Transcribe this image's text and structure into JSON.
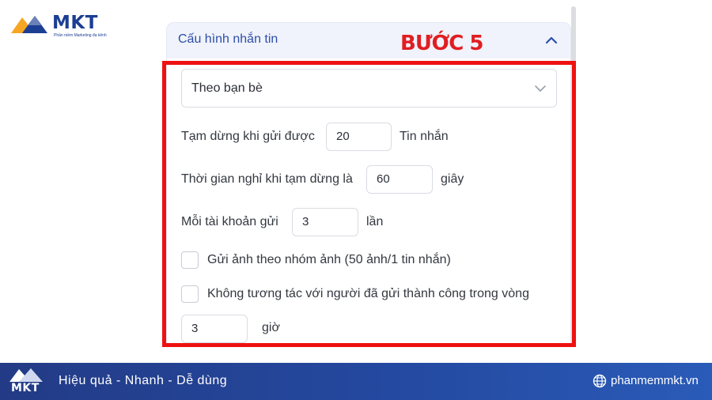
{
  "brand": {
    "logo_text": "MKT",
    "logo_tagline": "Phần mềm Marketing đa kênh"
  },
  "step_label": "BƯỚC 5",
  "panel": {
    "title": "Cấu hình nhắn tin",
    "select_value": "Theo bạn bè",
    "pause_row": {
      "label": "Tạm dừng khi gửi được",
      "value": "20",
      "unit": "Tin nhắn"
    },
    "rest_row": {
      "label": "Thời gian nghỉ khi tạm dừng là",
      "value": "60",
      "unit": "giây"
    },
    "per_account_row": {
      "label": "Mỗi tài khoản gửi",
      "value": "3",
      "unit": "lần"
    },
    "checkbox_group_images": {
      "label": "Gửi ảnh theo nhóm ảnh (50 ảnh/1 tin nhắn)",
      "checked": false
    },
    "checkbox_no_interact": {
      "label": "Không tương tác với người đã gửi thành công trong vòng",
      "checked": false
    },
    "hours_row": {
      "value": "3",
      "unit": "giờ"
    }
  },
  "footer": {
    "logo_text": "MKT",
    "tagline": "Hiệu quả - Nhanh  - Dễ dùng",
    "website": "phanmemmkt.vn"
  },
  "colors": {
    "highlight": "#ee1111",
    "step_label": "#e01e22",
    "panel_title": "#2d4ea8",
    "footer_bg": "#2449a0"
  }
}
